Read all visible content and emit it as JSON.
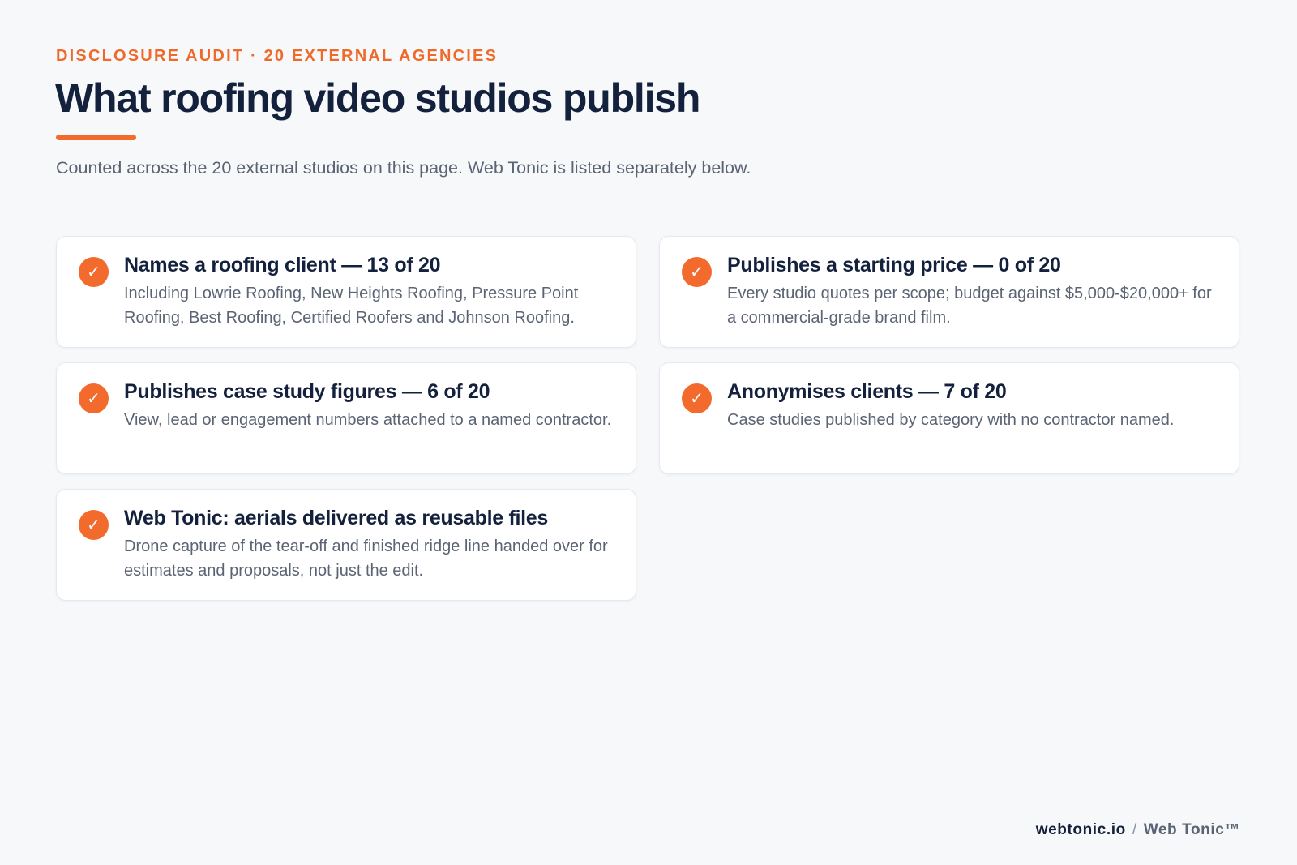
{
  "header": {
    "eyebrow": "DISCLOSURE AUDIT · 20 EXTERNAL AGENCIES",
    "title": "What roofing video studios publish",
    "subtitle": "Counted across the 20 external studios on this page. Web Tonic is listed separately below."
  },
  "cards": [
    {
      "icon": "check-icon",
      "title": "Names a roofing client — 13 of 20",
      "body": "Including Lowrie Roofing, New Heights Roofing, Pressure Point Roofing, Best Roofing, Certified Roofers and Johnson Roofing."
    },
    {
      "icon": "check-icon",
      "title": "Publishes a starting price — 0 of 20",
      "body": "Every studio quotes per scope; budget against $5,000-$20,000+ for a commercial-grade brand film."
    },
    {
      "icon": "check-icon",
      "title": "Publishes case study figures — 6 of 20",
      "body": "View, lead or engagement numbers attached to a named contractor."
    },
    {
      "icon": "check-icon",
      "title": "Anonymises clients — 7 of 20",
      "body": "Case studies published by category with no contractor named."
    },
    {
      "icon": "check-icon",
      "title": "Web Tonic: aerials delivered as reusable files",
      "body": "Drone capture of the tear-off and finished ridge line handed over for estimates and proposals, not just the edit."
    }
  ],
  "check_glyph": "✓",
  "footer": {
    "domain": "webtonic.io",
    "separator": "/",
    "brand": "Web Tonic™"
  },
  "colors": {
    "accent": "#f26a2c",
    "heading": "#14213d",
    "body": "#5b6474",
    "background": "#f6f8fa"
  }
}
